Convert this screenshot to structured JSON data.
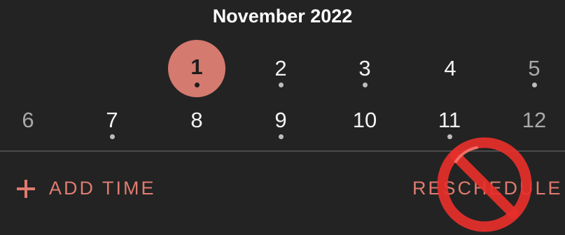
{
  "calendar": {
    "month_title": "November 2022",
    "row1": [
      {
        "day": "1",
        "selected": true,
        "dot": true
      },
      {
        "day": "2",
        "dot": true
      },
      {
        "day": "3",
        "dot": true
      },
      {
        "day": "4",
        "dot": false
      },
      {
        "day": "5",
        "weekend": true,
        "dot": true
      }
    ],
    "row2": [
      {
        "day": "6",
        "weekend": true,
        "dot": false
      },
      {
        "day": "7",
        "dot": true
      },
      {
        "day": "8",
        "dot": false
      },
      {
        "day": "9",
        "dot": true
      },
      {
        "day": "10",
        "dot": false
      },
      {
        "day": "11",
        "dot": true
      },
      {
        "day": "12",
        "weekend": true,
        "dot": false
      }
    ]
  },
  "actions": {
    "add_time": "ADD TIME",
    "reschedule": "RESCHEDULE"
  },
  "overlay": {
    "icon": "prohibited-icon",
    "color": "#e8302b"
  },
  "colors": {
    "background": "#232323",
    "accent": "#e07b6f",
    "selected_circle": "#d47a6f"
  }
}
